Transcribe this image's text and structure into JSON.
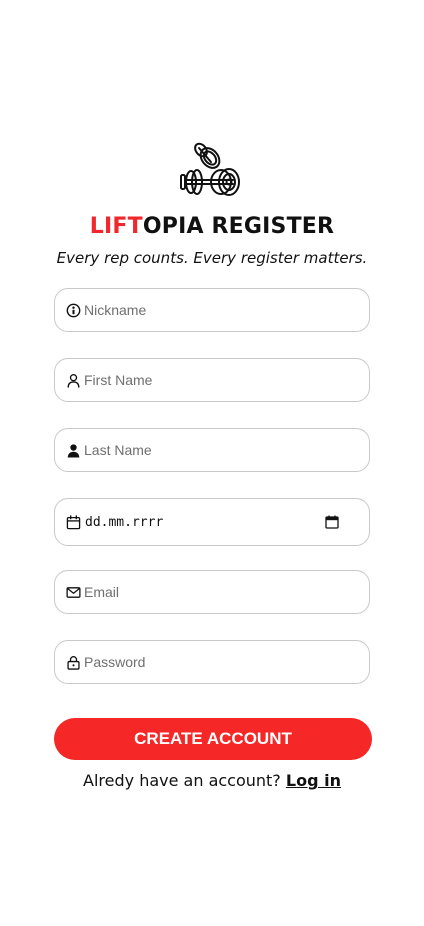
{
  "logo": {
    "icon": "dumbbell-icon"
  },
  "title": {
    "accent": "LIFT",
    "rest": "OPIA REGISTER"
  },
  "subtitle": "Every rep counts. Every register matters.",
  "form": {
    "nickname": {
      "placeholder": "Nickname",
      "icon": "id-icon"
    },
    "first_name": {
      "placeholder": "First Name",
      "icon": "user-outline-icon"
    },
    "last_name": {
      "placeholder": "Last Name",
      "icon": "user-filled-icon"
    },
    "birth_date": {
      "value": "dd.mm.rrrr",
      "icon": "calendar-icon"
    },
    "email": {
      "placeholder": "Email",
      "icon": "mail-icon"
    },
    "password": {
      "placeholder": "Password",
      "icon": "lock-icon"
    }
  },
  "create_button": "CREATE ACCOUNT",
  "login": {
    "prompt": "Alredy have an account?",
    "link": "Log in"
  },
  "colors": {
    "accent": "#f0282b",
    "button": "#f52727",
    "border": "#c9c9c9"
  }
}
